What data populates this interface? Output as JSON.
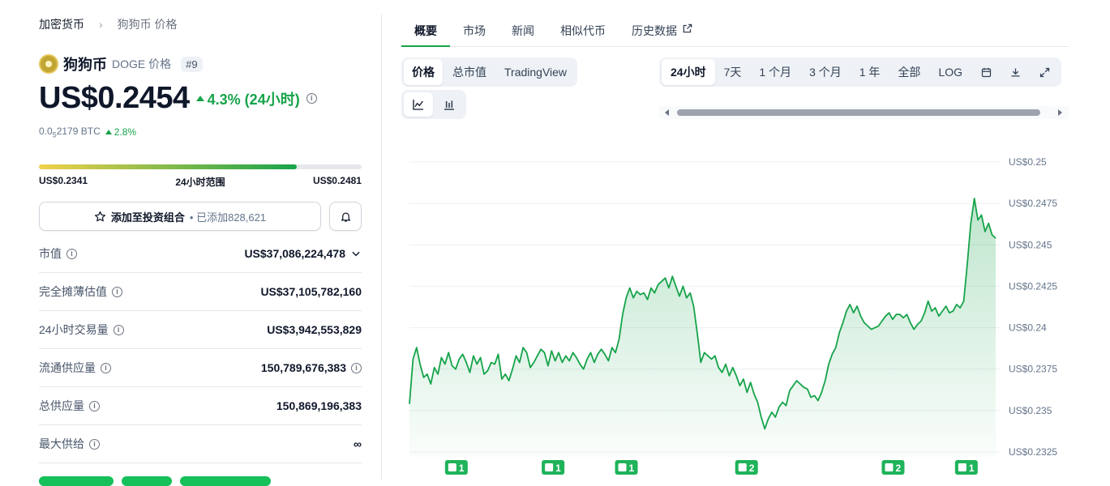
{
  "breadcrumb": {
    "root": "加密货币",
    "current": "狗狗币 价格"
  },
  "coin": {
    "name": "狗狗币",
    "symbol_label": "DOGE 价格",
    "rank": "#9"
  },
  "price": {
    "value": "US$0.2454",
    "change": "4.3% (24小时)",
    "btc_prefix": "0.0",
    "btc_sub": "5",
    "btc_rest": "2179 BTC",
    "btc_change": "2.8%"
  },
  "range": {
    "low": "US$0.2341",
    "label": "24小时范围",
    "high": "US$0.2481",
    "fill_fraction": 0.8
  },
  "portfolio": {
    "add_label": "添加至投资组合",
    "added": "• 已添加828,621"
  },
  "stats": [
    {
      "label": "市值",
      "value": "US$37,086,224,478"
    },
    {
      "label": "完全摊薄估值",
      "value": "US$37,105,782,160"
    },
    {
      "label": "24小时交易量",
      "value": "US$3,942,553,829"
    },
    {
      "label": "流通供应量",
      "value": "150,789,676,383"
    },
    {
      "label": "总供应量",
      "value": "150,869,196,383"
    },
    {
      "label": "最大供给",
      "value": "∞"
    }
  ],
  "tabs": [
    "概要",
    "市场",
    "新闻",
    "相似代币",
    "历史数据"
  ],
  "chart_modes": [
    "价格",
    "总市值",
    "TradingView"
  ],
  "timeframes": [
    "24小时",
    "7天",
    "1 个月",
    "3 个月",
    "1 年",
    "全部",
    "LOG"
  ],
  "colors": {
    "accent": "#16a34a",
    "line": "#16a34a"
  },
  "chart_data": {
    "type": "area",
    "title": "",
    "xlabel": "",
    "ylabel": "",
    "ylim": [
      0.2325,
      0.25
    ],
    "yticks": [
      "US$0.25",
      "US$0.2475",
      "US$0.245",
      "US$0.2425",
      "US$0.24",
      "US$0.2375",
      "US$0.235",
      "US$0.2325"
    ],
    "ytick_values": [
      0.25,
      0.2475,
      0.245,
      0.2425,
      0.24,
      0.2375,
      0.235,
      0.2325
    ],
    "series": [
      {
        "values": [
          0.2354,
          0.2381,
          0.2388,
          0.2378,
          0.237,
          0.2372,
          0.2366,
          0.2376,
          0.2372,
          0.2382,
          0.2378,
          0.2385,
          0.2377,
          0.2375,
          0.2381,
          0.2384,
          0.2379,
          0.2373,
          0.2383,
          0.2378,
          0.2382,
          0.2372,
          0.2374,
          0.2379,
          0.2378,
          0.2384,
          0.2369,
          0.2372,
          0.2368,
          0.2375,
          0.2383,
          0.2379,
          0.2388,
          0.2385,
          0.2376,
          0.2379,
          0.2383,
          0.2387,
          0.2385,
          0.2377,
          0.2386,
          0.238,
          0.2385,
          0.2379,
          0.2383,
          0.238,
          0.2385,
          0.2382,
          0.2378,
          0.2375,
          0.2381,
          0.2385,
          0.2379,
          0.2384,
          0.2387,
          0.2384,
          0.238,
          0.2388,
          0.2385,
          0.2393,
          0.2408,
          0.2418,
          0.2424,
          0.2418,
          0.2422,
          0.242,
          0.2421,
          0.2417,
          0.2424,
          0.2421,
          0.2426,
          0.2428,
          0.243,
          0.2424,
          0.2431,
          0.2425,
          0.2419,
          0.2425,
          0.2418,
          0.2421,
          0.2413,
          0.2397,
          0.2379,
          0.2385,
          0.2383,
          0.2381,
          0.2383,
          0.2376,
          0.2373,
          0.2378,
          0.2371,
          0.2376,
          0.2371,
          0.2365,
          0.2369,
          0.2361,
          0.2367,
          0.236,
          0.2355,
          0.2346,
          0.2339,
          0.2345,
          0.2349,
          0.2346,
          0.2352,
          0.2355,
          0.2353,
          0.2362,
          0.2365,
          0.2368,
          0.2366,
          0.2364,
          0.2363,
          0.2358,
          0.2359,
          0.2356,
          0.2361,
          0.2368,
          0.2378,
          0.2384,
          0.2388,
          0.2397,
          0.2403,
          0.241,
          0.2414,
          0.2409,
          0.2413,
          0.2407,
          0.2403,
          0.2401,
          0.2399,
          0.24,
          0.2401,
          0.2404,
          0.2407,
          0.2409,
          0.2405,
          0.2408,
          0.2408,
          0.2406,
          0.2408,
          0.2403,
          0.2399,
          0.2402,
          0.2404,
          0.2409,
          0.2416,
          0.241,
          0.2412,
          0.2407,
          0.241,
          0.2413,
          0.2409,
          0.241,
          0.2414,
          0.2412,
          0.2416,
          0.2438,
          0.2463,
          0.2478,
          0.2465,
          0.2468,
          0.2458,
          0.2463,
          0.2456,
          0.2454
        ]
      }
    ]
  },
  "news_markers": [
    {
      "count": "1",
      "pos": 0.08
    },
    {
      "count": "1",
      "pos": 0.245
    },
    {
      "count": "1",
      "pos": 0.37
    },
    {
      "count": "2",
      "pos": 0.575
    },
    {
      "count": "2",
      "pos": 0.825
    },
    {
      "count": "1",
      "pos": 0.95
    }
  ]
}
